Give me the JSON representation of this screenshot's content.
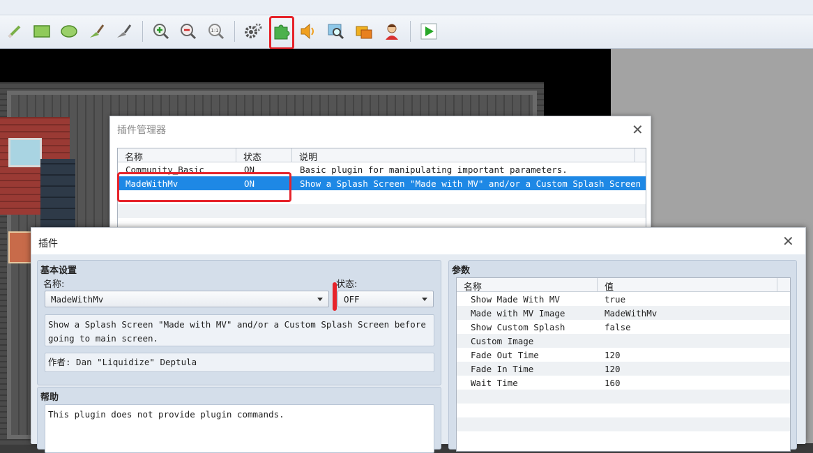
{
  "toolbar": {
    "icons": [
      "pencil-icon",
      "rectangle-icon",
      "ellipse-icon",
      "fill-icon",
      "shadow-pen-icon",
      "zoom-in-icon",
      "zoom-out-icon",
      "actual-size-icon",
      "database-icon",
      "plugin-manager-icon",
      "sound-test-icon",
      "event-searcher-icon",
      "resource-manager-icon",
      "character-generator-icon",
      "playtest-icon"
    ],
    "actual_size_label": "1:1"
  },
  "plugin_manager": {
    "title": "插件管理器",
    "columns": [
      "名称",
      "状态",
      "说明"
    ],
    "rows": [
      {
        "name": "Community_Basic",
        "status": "ON",
        "description": "Basic plugin for manipulating important parameters."
      },
      {
        "name": "MadeWithMv",
        "status": "ON",
        "description": "Show a Splash Screen \"Made with MV\" and/or a Custom Splash Screen be…"
      }
    ]
  },
  "plugin_dialog": {
    "title": "插件",
    "basic": {
      "title": "基本设置",
      "name_label": "名称:",
      "name_value": "MadeWithMv",
      "status_label": "状态:",
      "status_value": "OFF",
      "description": "Show a Splash Screen \"Made with MV\" and/or a Custom Splash Screen before going to main screen.",
      "author": "作者: Dan \"Liquidize\" Deptula"
    },
    "help": {
      "title": "帮助",
      "text": "This plugin does not provide plugin commands."
    },
    "params": {
      "title": "参数",
      "columns": [
        "名称",
        "值"
      ],
      "rows": [
        {
          "name": "Show Made With MV",
          "value": "true"
        },
        {
          "name": "Made with MV Image",
          "value": "MadeWithMv"
        },
        {
          "name": "Show Custom Splash",
          "value": "false"
        },
        {
          "name": "Custom Image",
          "value": ""
        },
        {
          "name": "Fade Out Time",
          "value": "120"
        },
        {
          "name": "Fade In Time",
          "value": "120"
        },
        {
          "name": "Wait Time",
          "value": "160"
        }
      ]
    }
  },
  "colors": {
    "selection": "#1e88e5",
    "highlight": "#e6232a",
    "panel": "#d4deea"
  }
}
